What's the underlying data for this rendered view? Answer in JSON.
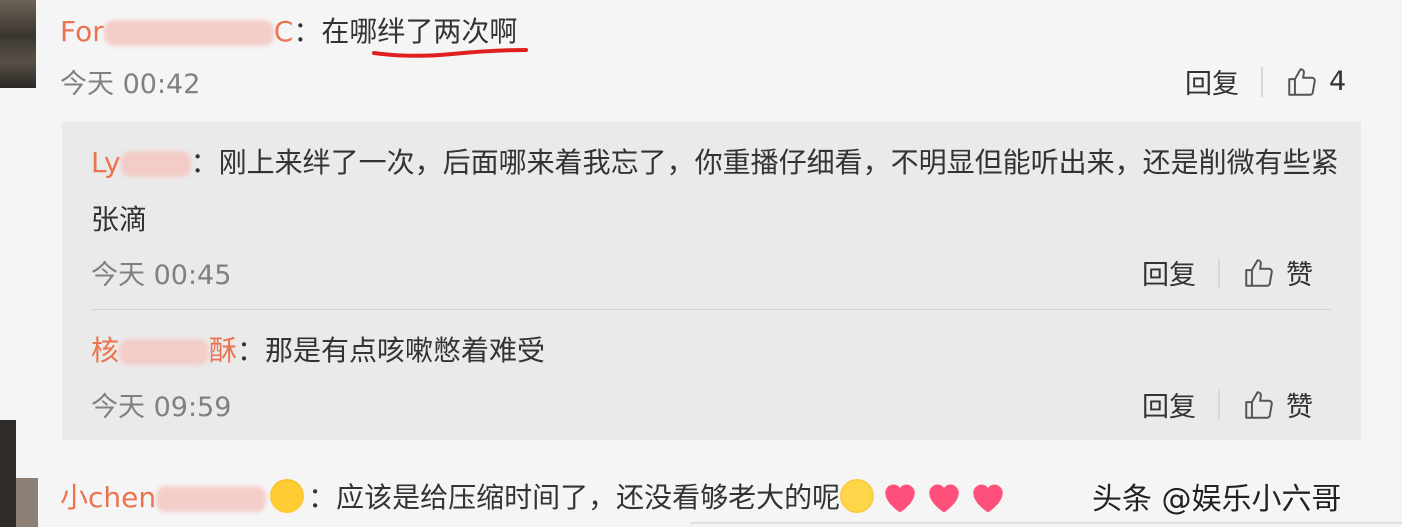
{
  "comment": {
    "author_prefix": "For",
    "author_suffix": "C",
    "text": "：在哪绊了两次啊",
    "time": "今天 00:42",
    "reply_label": "回复",
    "like_count": "4"
  },
  "replies": [
    {
      "author_prefix": "Ly",
      "author_suffix": "",
      "text": "：刚上来绊了一次，后面哪来着我忘了，你重播仔细看，不明显但能听出来，还是削微有些紧张滴",
      "time": "今天 00:45",
      "reply_label": "回复",
      "like_label": "赞"
    },
    {
      "author_prefix": "核",
      "author_suffix": "酥",
      "text": "：那是有点咳嗽憋着难受",
      "time": "今天 09:59",
      "reply_label": "回复",
      "like_label": "赞"
    }
  ],
  "bottom_comment": {
    "author_prefix": "小chen",
    "text": "：应该是给压缩时间了，还没看够老大的呢"
  },
  "watermark": "头条 @娱乐小六哥",
  "colors": {
    "accent": "#eb7350",
    "text": "#333333",
    "muted": "#808080"
  }
}
